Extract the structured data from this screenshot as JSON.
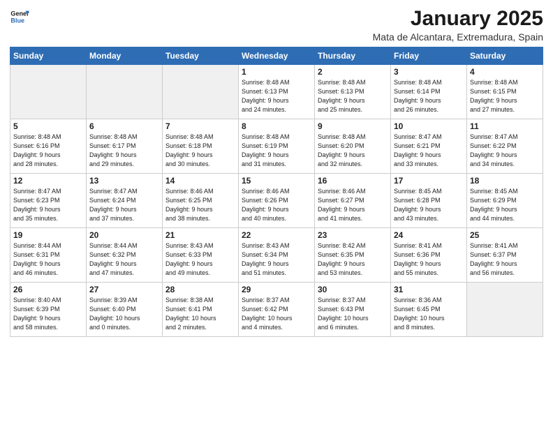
{
  "header": {
    "logo_line1": "General",
    "logo_line2": "Blue",
    "title": "January 2025",
    "subtitle": "Mata de Alcantara, Extremadura, Spain"
  },
  "days_of_week": [
    "Sunday",
    "Monday",
    "Tuesday",
    "Wednesday",
    "Thursday",
    "Friday",
    "Saturday"
  ],
  "weeks": [
    [
      {
        "day": "",
        "info": ""
      },
      {
        "day": "",
        "info": ""
      },
      {
        "day": "",
        "info": ""
      },
      {
        "day": "1",
        "info": "Sunrise: 8:48 AM\nSunset: 6:13 PM\nDaylight: 9 hours\nand 24 minutes."
      },
      {
        "day": "2",
        "info": "Sunrise: 8:48 AM\nSunset: 6:13 PM\nDaylight: 9 hours\nand 25 minutes."
      },
      {
        "day": "3",
        "info": "Sunrise: 8:48 AM\nSunset: 6:14 PM\nDaylight: 9 hours\nand 26 minutes."
      },
      {
        "day": "4",
        "info": "Sunrise: 8:48 AM\nSunset: 6:15 PM\nDaylight: 9 hours\nand 27 minutes."
      }
    ],
    [
      {
        "day": "5",
        "info": "Sunrise: 8:48 AM\nSunset: 6:16 PM\nDaylight: 9 hours\nand 28 minutes."
      },
      {
        "day": "6",
        "info": "Sunrise: 8:48 AM\nSunset: 6:17 PM\nDaylight: 9 hours\nand 29 minutes."
      },
      {
        "day": "7",
        "info": "Sunrise: 8:48 AM\nSunset: 6:18 PM\nDaylight: 9 hours\nand 30 minutes."
      },
      {
        "day": "8",
        "info": "Sunrise: 8:48 AM\nSunset: 6:19 PM\nDaylight: 9 hours\nand 31 minutes."
      },
      {
        "day": "9",
        "info": "Sunrise: 8:48 AM\nSunset: 6:20 PM\nDaylight: 9 hours\nand 32 minutes."
      },
      {
        "day": "10",
        "info": "Sunrise: 8:47 AM\nSunset: 6:21 PM\nDaylight: 9 hours\nand 33 minutes."
      },
      {
        "day": "11",
        "info": "Sunrise: 8:47 AM\nSunset: 6:22 PM\nDaylight: 9 hours\nand 34 minutes."
      }
    ],
    [
      {
        "day": "12",
        "info": "Sunrise: 8:47 AM\nSunset: 6:23 PM\nDaylight: 9 hours\nand 35 minutes."
      },
      {
        "day": "13",
        "info": "Sunrise: 8:47 AM\nSunset: 6:24 PM\nDaylight: 9 hours\nand 37 minutes."
      },
      {
        "day": "14",
        "info": "Sunrise: 8:46 AM\nSunset: 6:25 PM\nDaylight: 9 hours\nand 38 minutes."
      },
      {
        "day": "15",
        "info": "Sunrise: 8:46 AM\nSunset: 6:26 PM\nDaylight: 9 hours\nand 40 minutes."
      },
      {
        "day": "16",
        "info": "Sunrise: 8:46 AM\nSunset: 6:27 PM\nDaylight: 9 hours\nand 41 minutes."
      },
      {
        "day": "17",
        "info": "Sunrise: 8:45 AM\nSunset: 6:28 PM\nDaylight: 9 hours\nand 43 minutes."
      },
      {
        "day": "18",
        "info": "Sunrise: 8:45 AM\nSunset: 6:29 PM\nDaylight: 9 hours\nand 44 minutes."
      }
    ],
    [
      {
        "day": "19",
        "info": "Sunrise: 8:44 AM\nSunset: 6:31 PM\nDaylight: 9 hours\nand 46 minutes."
      },
      {
        "day": "20",
        "info": "Sunrise: 8:44 AM\nSunset: 6:32 PM\nDaylight: 9 hours\nand 47 minutes."
      },
      {
        "day": "21",
        "info": "Sunrise: 8:43 AM\nSunset: 6:33 PM\nDaylight: 9 hours\nand 49 minutes."
      },
      {
        "day": "22",
        "info": "Sunrise: 8:43 AM\nSunset: 6:34 PM\nDaylight: 9 hours\nand 51 minutes."
      },
      {
        "day": "23",
        "info": "Sunrise: 8:42 AM\nSunset: 6:35 PM\nDaylight: 9 hours\nand 53 minutes."
      },
      {
        "day": "24",
        "info": "Sunrise: 8:41 AM\nSunset: 6:36 PM\nDaylight: 9 hours\nand 55 minutes."
      },
      {
        "day": "25",
        "info": "Sunrise: 8:41 AM\nSunset: 6:37 PM\nDaylight: 9 hours\nand 56 minutes."
      }
    ],
    [
      {
        "day": "26",
        "info": "Sunrise: 8:40 AM\nSunset: 6:39 PM\nDaylight: 9 hours\nand 58 minutes."
      },
      {
        "day": "27",
        "info": "Sunrise: 8:39 AM\nSunset: 6:40 PM\nDaylight: 10 hours\nand 0 minutes."
      },
      {
        "day": "28",
        "info": "Sunrise: 8:38 AM\nSunset: 6:41 PM\nDaylight: 10 hours\nand 2 minutes."
      },
      {
        "day": "29",
        "info": "Sunrise: 8:37 AM\nSunset: 6:42 PM\nDaylight: 10 hours\nand 4 minutes."
      },
      {
        "day": "30",
        "info": "Sunrise: 8:37 AM\nSunset: 6:43 PM\nDaylight: 10 hours\nand 6 minutes."
      },
      {
        "day": "31",
        "info": "Sunrise: 8:36 AM\nSunset: 6:45 PM\nDaylight: 10 hours\nand 8 minutes."
      },
      {
        "day": "",
        "info": ""
      }
    ]
  ]
}
